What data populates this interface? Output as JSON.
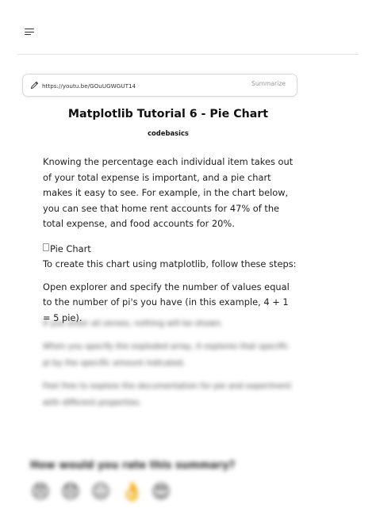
{
  "header": {
    "menu_icon": "hamburger-menu-icon"
  },
  "url_bar": {
    "icon": "pencil-icon",
    "value": "https://youtu.be/GOuUGWGUT14",
    "summarize_label": "Summarize"
  },
  "article": {
    "title": "Matplotlib Tutorial 6 - Pie Chart",
    "author": "codebasics",
    "paragraph_1": "Knowing the percentage each individual item takes out of your total expense is important, and a pie chart makes it easy to see. For example, in the chart below, you can see that home rent accounts for 47% of the total expense, and food accounts for 20%.",
    "image_alt": "Pie Chart",
    "paragraph_2": "To create this chart using matplotlib, follow these steps:",
    "paragraph_3": "Open explorer and specify the number of values equal to the number of pi's you have (in this example, 4 + 1 = 5 pie)."
  },
  "blurred": {
    "paragraph_1": "If you enter all zeroes, nothing will be shown.",
    "paragraph_2": "When you specify the exploded array, it explores that specific pi by the specific amount indicated.",
    "paragraph_3": "Feel free to explore the documentation for pie and experiment with different properties."
  },
  "rating": {
    "question": "How would you rate this summary?",
    "options": [
      {
        "glyph": "😠",
        "icon": "angry-face-icon"
      },
      {
        "glyph": "😞",
        "icon": "sad-face-icon"
      },
      {
        "glyph": "😐",
        "icon": "neutral-face-icon"
      },
      {
        "glyph": "👌",
        "icon": "ok-hand-icon"
      },
      {
        "glyph": "😍",
        "icon": "heart-eyes-icon"
      }
    ]
  },
  "colors": {
    "accent_gray": "#9a9a9a",
    "border": "#d9d9d9",
    "text": "#1e1e1e"
  }
}
